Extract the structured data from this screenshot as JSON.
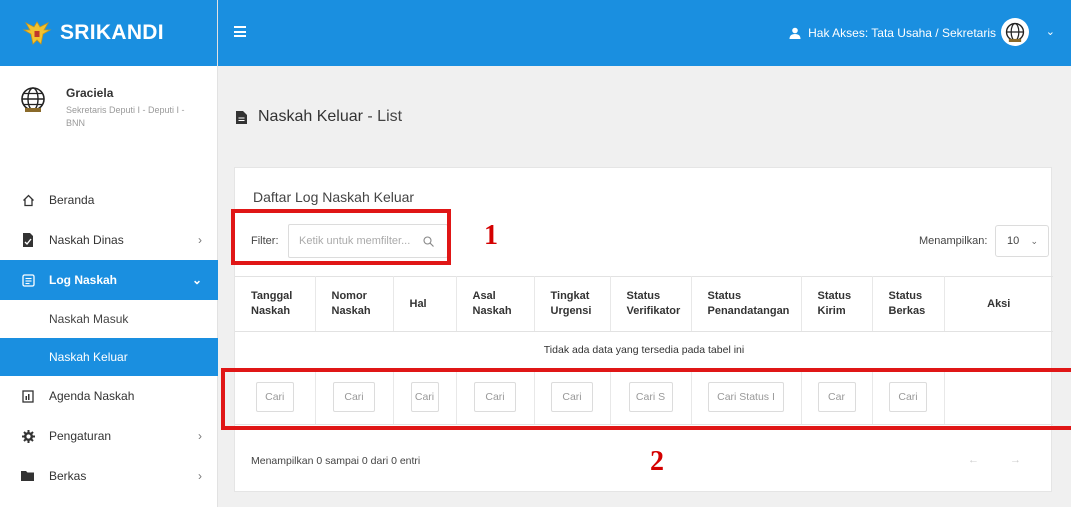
{
  "app": {
    "name": "SRIKANDI"
  },
  "user": {
    "name": "Graciela",
    "role": "Sekretaris Deputi I - Deputi I - BNN"
  },
  "sidebar": {
    "items": [
      {
        "label": "Beranda",
        "icon": "home-icon"
      },
      {
        "label": "Naskah Dinas",
        "icon": "document-icon",
        "chevron": "›"
      },
      {
        "label": "Log Naskah",
        "icon": "log-icon",
        "chevron": "⌄",
        "active": true
      },
      {
        "label": "Naskah Masuk"
      },
      {
        "label": "Naskah Keluar",
        "selected": true
      },
      {
        "label": "Agenda Naskah",
        "icon": "agenda-icon"
      },
      {
        "label": "Pengaturan",
        "icon": "gear-icon",
        "chevron": "›"
      },
      {
        "label": "Berkas",
        "icon": "folder-icon",
        "chevron": "›"
      }
    ]
  },
  "topbar": {
    "access": "Hak Akses: Tata Usaha / Sekretaris"
  },
  "page": {
    "title_main": "Naskah Keluar",
    "title_sub": " - List"
  },
  "card": {
    "title": "Daftar Log Naskah Keluar",
    "filter_label": "Filter:",
    "filter_placeholder": "Ketik untuk memfilter...",
    "show_label": "Menampilkan:",
    "show_value": "10",
    "empty_text": "Tidak ada data yang tersedia pada tabel ini",
    "entries_text": "Menampilkan 0 sampai 0 dari 0 entri",
    "pager": "← →"
  },
  "table": {
    "columns": [
      {
        "l1": "Tanggal",
        "l2": "Naskah"
      },
      {
        "l1": "Nomor",
        "l2": "Naskah"
      },
      {
        "l1": "Hal",
        "l2": ""
      },
      {
        "l1": "Asal",
        "l2": "Naskah"
      },
      {
        "l1": "Tingkat",
        "l2": "Urgensi"
      },
      {
        "l1": "Status",
        "l2": "Verifikator"
      },
      {
        "l1": "Status",
        "l2": "Penandatangan"
      },
      {
        "l1": "Status",
        "l2": "Kirim"
      },
      {
        "l1": "Status",
        "l2": "Berkas"
      },
      {
        "l1": "Aksi",
        "l2": ""
      }
    ],
    "search_placeholders": [
      "Cari",
      "Cari",
      "Cari",
      "Cari",
      "Cari",
      "Cari S",
      "Cari Status I",
      "Car",
      "Cari"
    ]
  },
  "annotations": {
    "one": "1",
    "two": "2"
  },
  "colors": {
    "primary": "#1a8fe0",
    "annotation": "#e01616"
  }
}
